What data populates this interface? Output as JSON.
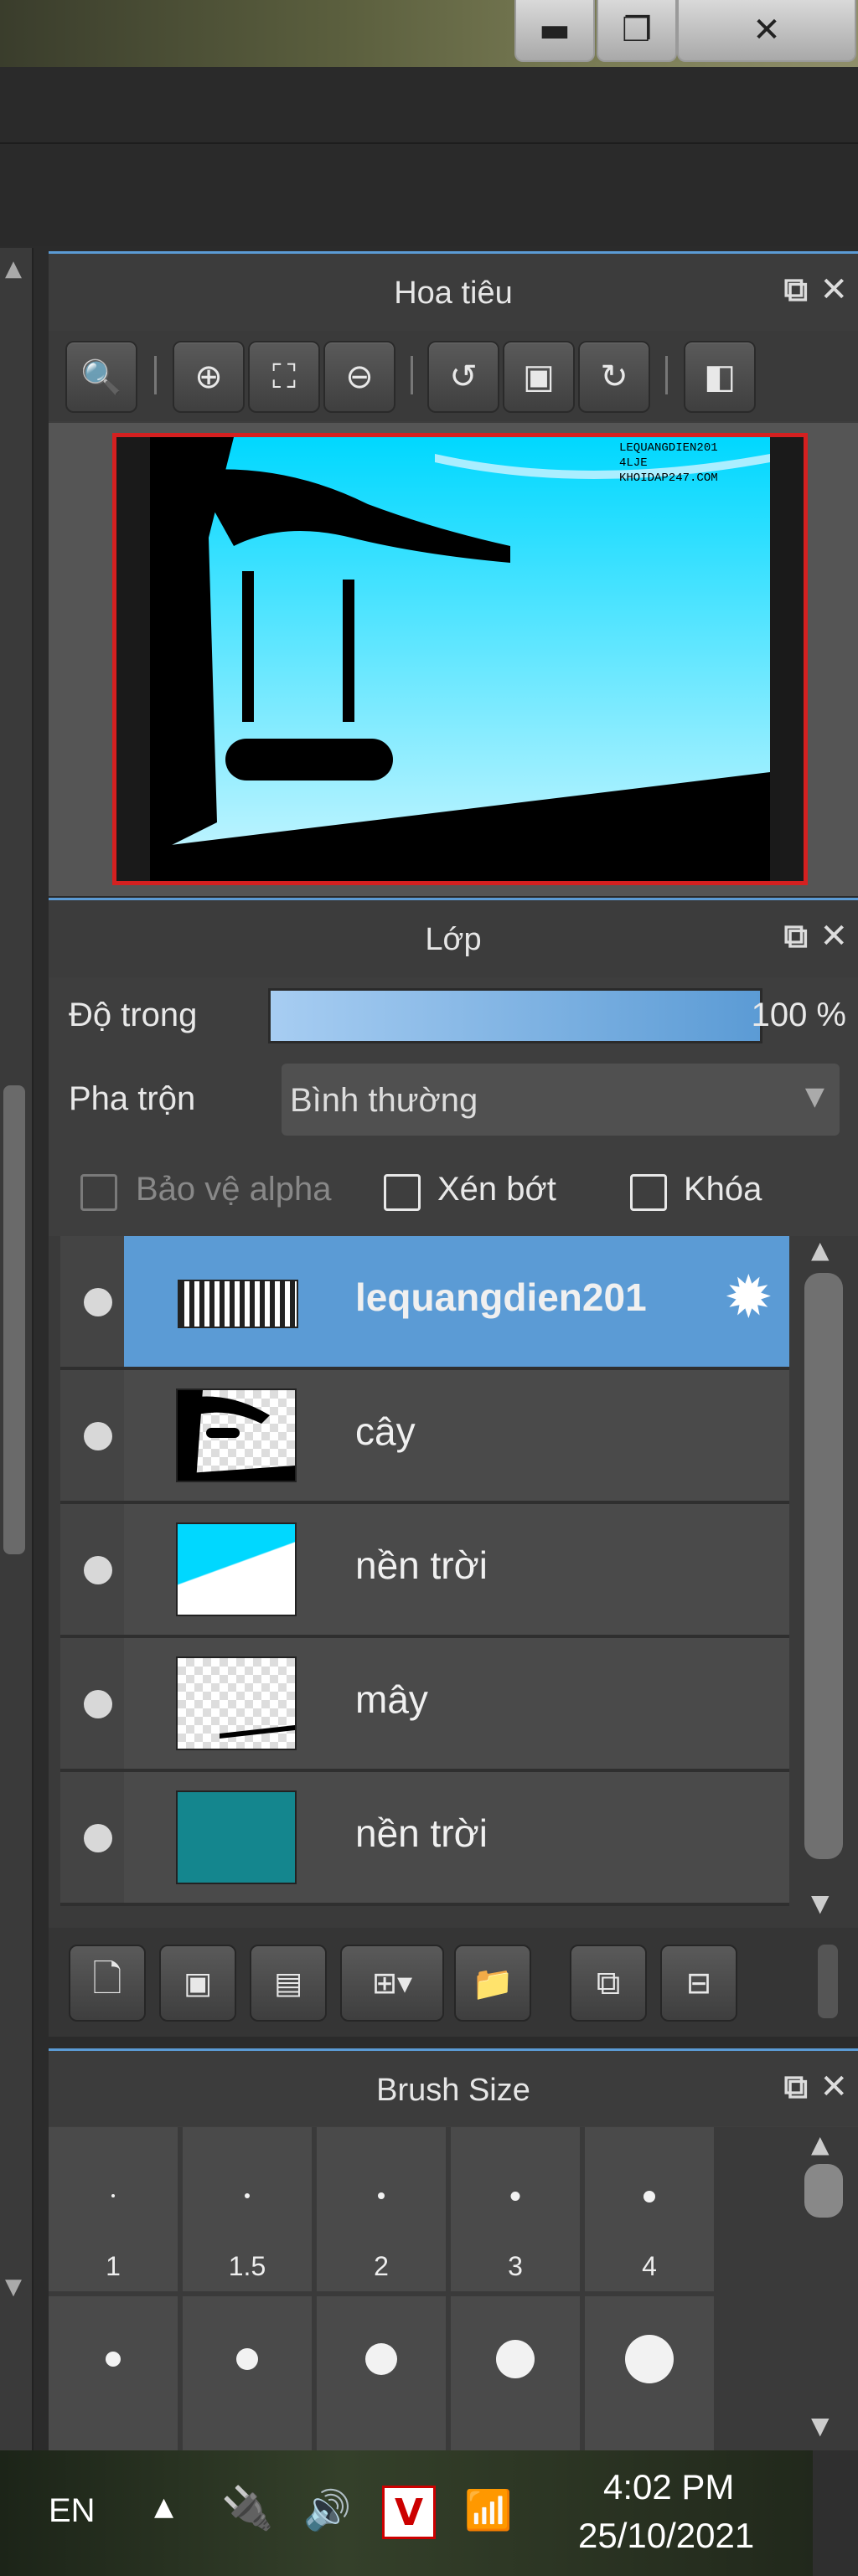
{
  "window": {
    "controls": {
      "minimize": "minimize-icon",
      "maximize": "restore-icon",
      "close": "close-icon"
    }
  },
  "navigator": {
    "title": "Hoa tiêu",
    "toolbar": [
      "zoom-reset-icon",
      "zoom-in-icon",
      "fit-screen-icon",
      "zoom-out-icon",
      "rotate-left-icon",
      "actual-size-icon",
      "rotate-right-icon",
      "flip-horizontal-icon"
    ],
    "preview_text": [
      "LEQUANGDIEN201",
      "4LJE",
      "KHOIDAP247.COM"
    ]
  },
  "layers": {
    "title": "Lớp",
    "opacity_label": "Độ trong",
    "opacity_value": "100 %",
    "opacity_fraction": 1.0,
    "blend_label": "Pha trộn",
    "blend_value": "Bình thường",
    "checks": {
      "protect_alpha": "Bảo vệ alpha",
      "clipping": "Xén bớt",
      "lock": "Khóa"
    },
    "items": [
      {
        "name": "lequangdien201",
        "selected": true
      },
      {
        "name": "cây",
        "selected": false
      },
      {
        "name": "nền trời",
        "selected": false
      },
      {
        "name": "mây",
        "selected": false
      },
      {
        "name": "nền trời",
        "selected": false
      }
    ],
    "bottom_buttons": [
      "new-layer-icon",
      "new-8bit-layer-icon",
      "new-1bit-layer-icon",
      "add-layer-dropdown-icon",
      "folder-icon",
      "duplicate-icon",
      "merge-icon"
    ]
  },
  "brush_size": {
    "title": "Brush Size",
    "sizes_row1": [
      "1",
      "1.5",
      "2",
      "3",
      "4"
    ]
  },
  "taskbar": {
    "language": "EN",
    "time": "4:02 PM",
    "date": "25/10/2021"
  }
}
